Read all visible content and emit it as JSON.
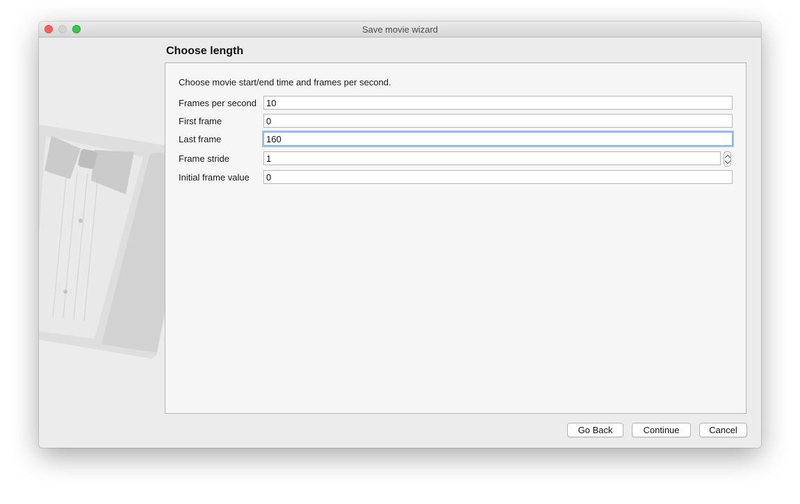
{
  "window": {
    "title": "Save movie wizard"
  },
  "page": {
    "title": "Choose length",
    "intro": "Choose movie start/end time and frames per second."
  },
  "fields": {
    "fps": {
      "label": "Frames per second",
      "value": "10"
    },
    "first_frame": {
      "label": "First frame",
      "value": "0"
    },
    "last_frame": {
      "label": "Last frame",
      "value": "160"
    },
    "frame_stride": {
      "label": "Frame stride",
      "value": "1"
    },
    "initial_frame_value": {
      "label": "Initial frame value",
      "value": "0"
    }
  },
  "buttons": {
    "go_back": "Go Back",
    "continue": "Continue",
    "cancel": "Cancel"
  },
  "icons": {
    "close": "close-icon",
    "minimize": "minimize-icon",
    "zoom": "zoom-icon",
    "watermark": "tuxedo-icon",
    "spinner": "stepper-icon"
  }
}
